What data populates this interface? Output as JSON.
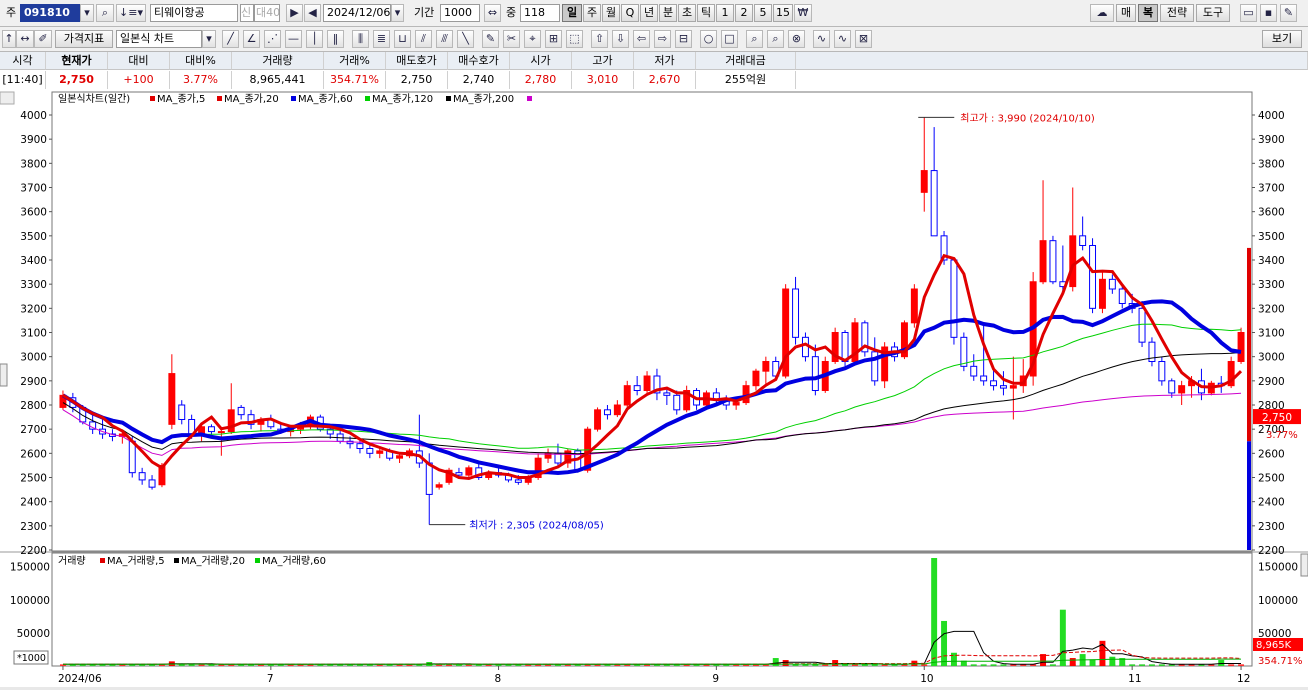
{
  "toolbar": {
    "ju_label": "주",
    "code": "091810",
    "name": "티웨이항공",
    "credit_badge": "신",
    "margin_badge": "대40",
    "date": "2024/12/06",
    "period_label": "기간",
    "period": "1000",
    "count_label": "중",
    "count": "118",
    "timeframes": [
      "일",
      "주",
      "월",
      "Q",
      "년",
      "분",
      "초",
      "틱",
      "1",
      "2",
      "5",
      "15"
    ],
    "active_timeframe": "일",
    "right_buttons": [
      "매",
      "복",
      "전략",
      "도구"
    ],
    "active_right": "복"
  },
  "toolbar2": {
    "price_indicator": "가격지표",
    "chart_type": "일본식 차트",
    "view_button": "보기"
  },
  "quote": {
    "headers": [
      "시각",
      "현재가",
      "대비",
      "대비%",
      "거래량",
      "거래%",
      "매도호가",
      "매수호가",
      "시가",
      "고가",
      "저가",
      "거래대금"
    ],
    "values": [
      "[11:40]",
      "2,750",
      "+100",
      "3.77%",
      "8,965,441",
      "354.71%",
      "2,750",
      "2,740",
      "2,780",
      "3,010",
      "2,670",
      "255억원"
    ]
  },
  "chart_data": {
    "type": "candlestick",
    "title": "일본식차트(일간)",
    "legend": [
      {
        "name": "MA_종가,5",
        "color": "#e00000"
      },
      {
        "name": "MA_종가,20",
        "color": "#e00000"
      },
      {
        "name": "MA_종가,60",
        "color": "#0000e0"
      },
      {
        "name": "MA_종가,120",
        "color": "#00d000"
      },
      {
        "name": "MA_종가,200",
        "color": "#000000"
      },
      {
        "name": "",
        "color": "#cc00cc"
      }
    ],
    "y_ticks": [
      2200,
      2300,
      2400,
      2500,
      2600,
      2700,
      2800,
      2900,
      3000,
      3100,
      3200,
      3300,
      3400,
      3500,
      3600,
      3700,
      3800,
      3900,
      4000
    ],
    "ylim": [
      2200,
      4000
    ],
    "x_ticks": [
      "2024/06",
      "7",
      "8",
      "9",
      "10",
      "11",
      "12"
    ],
    "high_annotation": "최고가 : 3,990 (2024/10/10)",
    "low_annotation": "최저가 : 2,305 (2024/08/05)",
    "current_price": "2,750",
    "current_change": "3.77%",
    "ohlc": [
      [
        2790,
        2860,
        2780,
        2840
      ],
      [
        2830,
        2850,
        2770,
        2790
      ],
      [
        2790,
        2800,
        2720,
        2730
      ],
      [
        2730,
        2760,
        2680,
        2700
      ],
      [
        2700,
        2740,
        2660,
        2680
      ],
      [
        2680,
        2700,
        2650,
        2670
      ],
      [
        2670,
        2690,
        2640,
        2680
      ],
      [
        2650,
        2670,
        2500,
        2520
      ],
      [
        2520,
        2540,
        2470,
        2490
      ],
      [
        2490,
        2510,
        2450,
        2460
      ],
      [
        2470,
        2560,
        2460,
        2550
      ],
      [
        2720,
        3010,
        2700,
        2930
      ],
      [
        2800,
        2820,
        2720,
        2740
      ],
      [
        2740,
        2760,
        2660,
        2680
      ],
      [
        2680,
        2720,
        2650,
        2710
      ],
      [
        2710,
        2720,
        2670,
        2690
      ],
      [
        2690,
        2700,
        2590,
        2690
      ],
      [
        2690,
        2890,
        2680,
        2780
      ],
      [
        2790,
        2800,
        2740,
        2760
      ],
      [
        2760,
        2780,
        2700,
        2720
      ],
      [
        2720,
        2750,
        2690,
        2740
      ],
      [
        2740,
        2760,
        2700,
        2710
      ],
      [
        2700,
        2730,
        2680,
        2690
      ],
      [
        2690,
        2710,
        2670,
        2700
      ],
      [
        2700,
        2730,
        2680,
        2720
      ],
      [
        2720,
        2760,
        2700,
        2750
      ],
      [
        2750,
        2760,
        2690,
        2700
      ],
      [
        2700,
        2710,
        2660,
        2680
      ],
      [
        2680,
        2700,
        2640,
        2650
      ],
      [
        2650,
        2670,
        2620,
        2640
      ],
      [
        2640,
        2660,
        2600,
        2620
      ],
      [
        2620,
        2640,
        2580,
        2600
      ],
      [
        2600,
        2630,
        2580,
        2610
      ],
      [
        2610,
        2620,
        2570,
        2580
      ],
      [
        2580,
        2600,
        2560,
        2590
      ],
      [
        2590,
        2620,
        2580,
        2610
      ],
      [
        2610,
        2760,
        2540,
        2560
      ],
      [
        2560,
        2600,
        2305,
        2430
      ],
      [
        2460,
        2480,
        2450,
        2470
      ],
      [
        2480,
        2540,
        2470,
        2530
      ],
      [
        2520,
        2540,
        2500,
        2510
      ],
      [
        2510,
        2550,
        2500,
        2540
      ],
      [
        2540,
        2560,
        2490,
        2500
      ],
      [
        2500,
        2530,
        2490,
        2520
      ],
      [
        2520,
        2540,
        2500,
        2510
      ],
      [
        2510,
        2520,
        2480,
        2490
      ],
      [
        2490,
        2510,
        2470,
        2480
      ],
      [
        2480,
        2510,
        2470,
        2500
      ],
      [
        2500,
        2600,
        2490,
        2580
      ],
      [
        2580,
        2620,
        2560,
        2600
      ],
      [
        2600,
        2640,
        2540,
        2560
      ],
      [
        2560,
        2620,
        2540,
        2610
      ],
      [
        2610,
        2620,
        2520,
        2530
      ],
      [
        2530,
        2710,
        2520,
        2700
      ],
      [
        2700,
        2790,
        2690,
        2780
      ],
      [
        2780,
        2800,
        2740,
        2760
      ],
      [
        2760,
        2820,
        2750,
        2800
      ],
      [
        2800,
        2900,
        2790,
        2880
      ],
      [
        2880,
        2920,
        2840,
        2860
      ],
      [
        2860,
        2940,
        2850,
        2920
      ],
      [
        2920,
        2950,
        2820,
        2850
      ],
      [
        2850,
        2870,
        2800,
        2840
      ],
      [
        2840,
        2860,
        2760,
        2780
      ],
      [
        2780,
        2880,
        2770,
        2860
      ],
      [
        2860,
        2870,
        2780,
        2800
      ],
      [
        2800,
        2860,
        2780,
        2850
      ],
      [
        2850,
        2870,
        2800,
        2820
      ],
      [
        2820,
        2840,
        2780,
        2800
      ],
      [
        2800,
        2830,
        2780,
        2810
      ],
      [
        2810,
        2900,
        2800,
        2880
      ],
      [
        2880,
        2950,
        2860,
        2940
      ],
      [
        2940,
        3000,
        2880,
        2980
      ],
      [
        2980,
        3000,
        2900,
        2920
      ],
      [
        2920,
        3300,
        2910,
        3280
      ],
      [
        3280,
        3330,
        3050,
        3080
      ],
      [
        3080,
        3100,
        2980,
        3000
      ],
      [
        3000,
        3050,
        2840,
        2860
      ],
      [
        2860,
        3000,
        2850,
        2980
      ],
      [
        2980,
        3120,
        2970,
        3100
      ],
      [
        3100,
        3110,
        2960,
        2980
      ],
      [
        2980,
        3160,
        2970,
        3140
      ],
      [
        3140,
        3150,
        3000,
        3020
      ],
      [
        3020,
        3080,
        2880,
        2900
      ],
      [
        2900,
        3060,
        2870,
        3040
      ],
      [
        3040,
        3060,
        2980,
        3000
      ],
      [
        3000,
        3150,
        2990,
        3140
      ],
      [
        3140,
        3300,
        3120,
        3280
      ],
      [
        3680,
        3990,
        3600,
        3770
      ],
      [
        3770,
        3950,
        3500,
        3500
      ],
      [
        3500,
        3520,
        3380,
        3400
      ],
      [
        3400,
        3410,
        3050,
        3080
      ],
      [
        3080,
        3100,
        2940,
        2960
      ],
      [
        2960,
        3010,
        2900,
        2920
      ],
      [
        2920,
        3130,
        2880,
        2900
      ],
      [
        2900,
        2950,
        2860,
        2880
      ],
      [
        2880,
        2940,
        2840,
        2870
      ],
      [
        2870,
        3000,
        2740,
        2880
      ],
      [
        2880,
        2990,
        2850,
        2920
      ],
      [
        2920,
        3350,
        2880,
        3310
      ],
      [
        3310,
        3730,
        3300,
        3480
      ],
      [
        3480,
        3500,
        3300,
        3310
      ],
      [
        3310,
        3460,
        3260,
        3290
      ],
      [
        3290,
        3700,
        3270,
        3500
      ],
      [
        3500,
        3580,
        3440,
        3460
      ],
      [
        3460,
        3490,
        3180,
        3200
      ],
      [
        3200,
        3350,
        3180,
        3320
      ],
      [
        3320,
        3340,
        3260,
        3280
      ],
      [
        3280,
        3300,
        3200,
        3220
      ],
      [
        3220,
        3260,
        3180,
        3200
      ],
      [
        3200,
        3230,
        3040,
        3060
      ],
      [
        3060,
        3080,
        2960,
        2980
      ],
      [
        2980,
        3000,
        2880,
        2900
      ],
      [
        2900,
        2910,
        2830,
        2850
      ],
      [
        2850,
        2900,
        2800,
        2880
      ],
      [
        2880,
        2920,
        2830,
        2900
      ],
      [
        2900,
        2950,
        2820,
        2850
      ],
      [
        2850,
        2900,
        2840,
        2890
      ],
      [
        2890,
        2920,
        2850,
        2880
      ],
      [
        2880,
        3000,
        2870,
        2980
      ],
      [
        2980,
        3120,
        2970,
        3100
      ]
    ],
    "volume": {
      "label": "거래량",
      "legend": [
        {
          "name": "MA_거래량,5",
          "color": "#e00000"
        },
        {
          "name": "MA_거래량,20",
          "color": "#000000"
        },
        {
          "name": "MA_거래량,60",
          "color": "#00d000"
        }
      ],
      "y_ticks": [
        50000,
        100000,
        150000
      ],
      "ylim": [
        0,
        160000
      ],
      "unit_label": "*1000",
      "current_volume": "8,965K",
      "current_pct": "354.71%",
      "spikes": [
        {
          "index": 88,
          "value": 163000
        },
        {
          "index": 89,
          "value": 68000
        },
        {
          "index": 90,
          "value": 20000
        },
        {
          "index": 91,
          "value": 8000
        },
        {
          "index": 99,
          "value": 18000
        },
        {
          "index": 101,
          "value": 85000
        },
        {
          "index": 102,
          "value": 12000
        },
        {
          "index": 103,
          "value": 18000
        },
        {
          "index": 104,
          "value": 10000
        },
        {
          "index": 105,
          "value": 38000
        },
        {
          "index": 106,
          "value": 14000
        },
        {
          "index": 107,
          "value": 12000
        },
        {
          "index": 72,
          "value": 12000
        },
        {
          "index": 73,
          "value": 9000
        },
        {
          "index": 78,
          "value": 9000
        },
        {
          "index": 86,
          "value": 8000
        },
        {
          "index": 11,
          "value": 7000
        },
        {
          "index": 37,
          "value": 6000
        },
        {
          "index": 117,
          "value": 9000
        }
      ]
    }
  }
}
